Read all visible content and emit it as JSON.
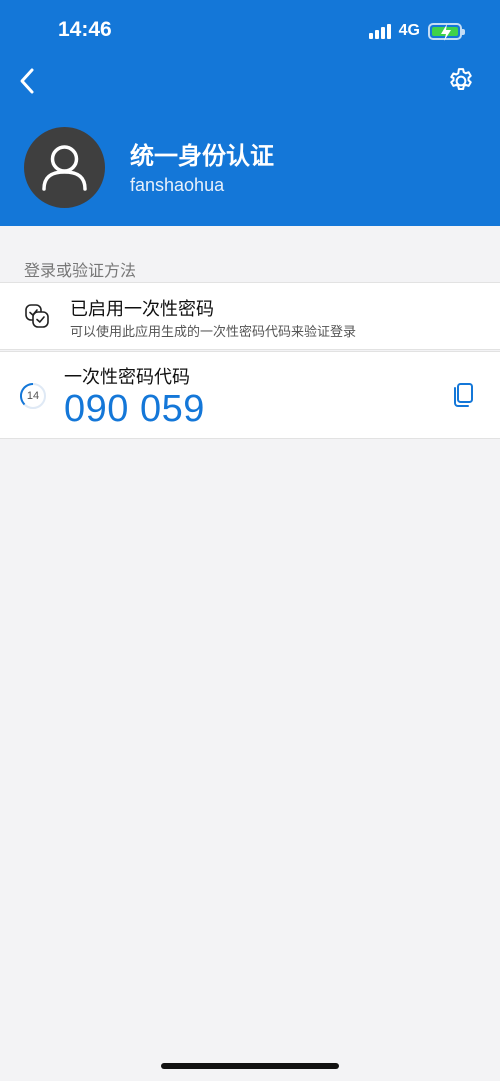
{
  "status_bar": {
    "time": "14:46",
    "network": "4G"
  },
  "header": {
    "back_icon": "chevron-left-icon",
    "settings_icon": "gear-icon",
    "avatar_icon": "user-avatar-icon",
    "account_name": "统一身份认证",
    "username": "fanshaohua"
  },
  "section": {
    "title": "登录或验证方法"
  },
  "method": {
    "icon": "verified-devices-icon",
    "title": "已启用一次性密码",
    "subtitle": "可以使用此应用生成的一次性密码代码来验证登录"
  },
  "otp": {
    "timer_seconds": "14",
    "label": "一次性密码代码",
    "code": "090 059",
    "copy_icon": "copy-icon"
  },
  "colors": {
    "primary": "#1477d8",
    "background": "#f3f3f5",
    "battery": "#3fd24a"
  }
}
